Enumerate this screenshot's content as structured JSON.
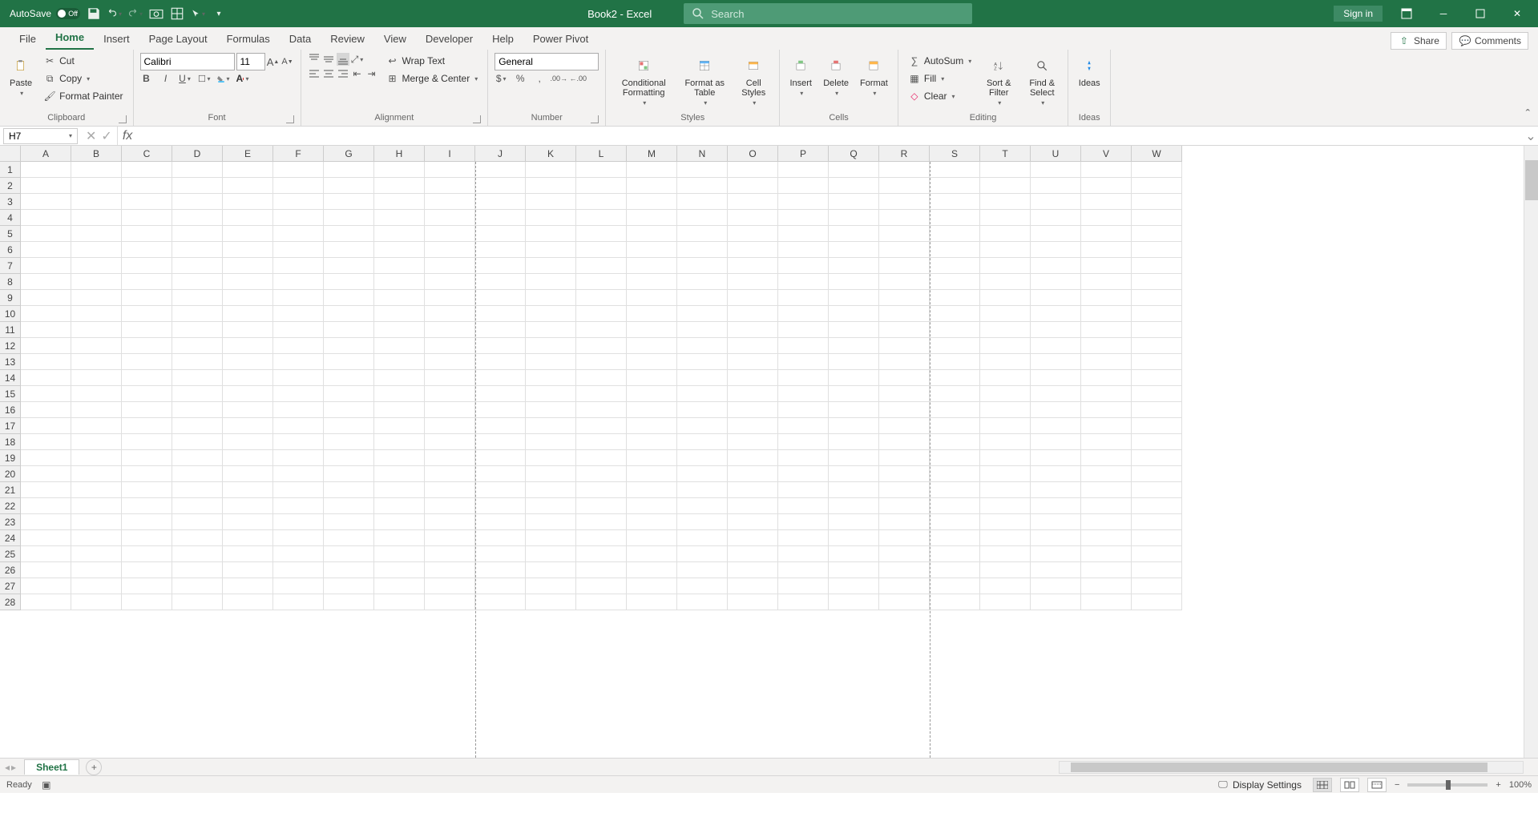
{
  "title_bar": {
    "autosave_label": "AutoSave",
    "autosave_state": "Off",
    "doc_name": "Book2 - Excel",
    "search_placeholder": "Search",
    "signin": "Sign in"
  },
  "tabs": {
    "items": [
      "File",
      "Home",
      "Insert",
      "Page Layout",
      "Formulas",
      "Data",
      "Review",
      "View",
      "Developer",
      "Help",
      "Power Pivot"
    ],
    "active": "Home",
    "share": "Share",
    "comments": "Comments"
  },
  "ribbon": {
    "clipboard": {
      "label": "Clipboard",
      "paste": "Paste",
      "cut": "Cut",
      "copy": "Copy",
      "fmtpainter": "Format Painter"
    },
    "font": {
      "label": "Font",
      "name": "Calibri",
      "size": "11"
    },
    "alignment": {
      "label": "Alignment",
      "wrap": "Wrap Text",
      "merge": "Merge & Center"
    },
    "number": {
      "label": "Number",
      "format": "General"
    },
    "styles": {
      "label": "Styles",
      "cond": "Conditional Formatting",
      "table": "Format as Table",
      "cell": "Cell Styles"
    },
    "cells": {
      "label": "Cells",
      "insert": "Insert",
      "delete": "Delete",
      "format": "Format"
    },
    "editing": {
      "label": "Editing",
      "sum": "AutoSum",
      "fill": "Fill",
      "clear": "Clear",
      "sort": "Sort & Filter",
      "find": "Find & Select"
    },
    "ideas": {
      "label": "Ideas",
      "btn": "Ideas"
    }
  },
  "formula_bar": {
    "name_box": "H7",
    "formula": ""
  },
  "columns": [
    "A",
    "B",
    "C",
    "D",
    "E",
    "F",
    "G",
    "H",
    "I",
    "J",
    "K",
    "L",
    "M",
    "N",
    "O",
    "P",
    "Q",
    "R",
    "S",
    "T",
    "U",
    "V",
    "W"
  ],
  "rows": [
    1,
    2,
    3,
    4,
    5,
    6,
    7,
    8,
    9,
    10,
    11,
    12,
    13,
    14,
    15,
    16,
    17,
    18,
    19,
    20,
    21,
    22,
    23,
    24,
    25,
    26,
    27,
    28
  ],
  "sheet_bar": {
    "active": "Sheet1"
  },
  "status_bar": {
    "ready": "Ready",
    "display": "Display Settings",
    "zoom": "100%"
  }
}
